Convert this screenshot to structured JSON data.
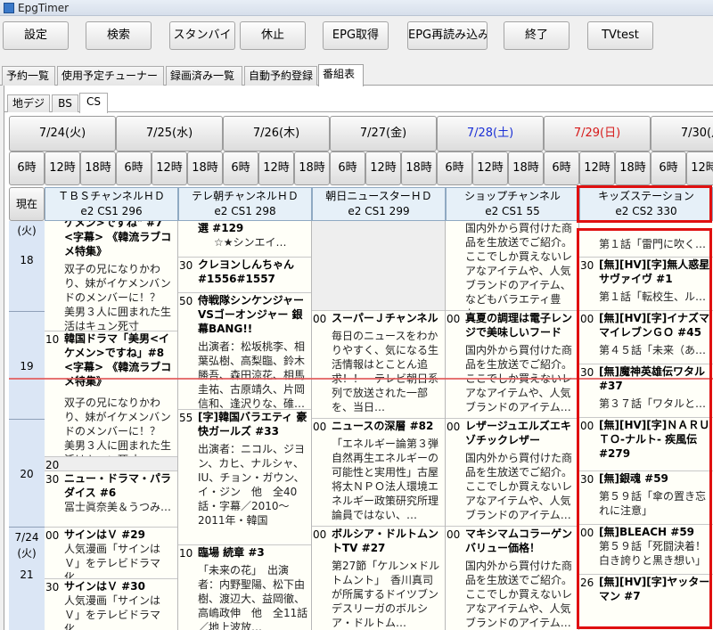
{
  "window": {
    "title": "EpgTimer"
  },
  "toolbar": {
    "buttons": [
      {
        "label": "設定"
      },
      {
        "label": "検索"
      },
      {
        "label": "スタンバイ"
      },
      {
        "label": "休止"
      },
      {
        "label": "EPG取得"
      },
      {
        "label": "EPG再読み込み"
      },
      {
        "label": "終了"
      },
      {
        "label": "TVtest"
      }
    ]
  },
  "main_tabs": [
    {
      "label": "予約一覧"
    },
    {
      "label": "使用予定チューナー"
    },
    {
      "label": "録画済み一覧"
    },
    {
      "label": "自動予約登録"
    },
    {
      "label": "番組表"
    }
  ],
  "sub_tabs": [
    {
      "label": "地デジ"
    },
    {
      "label": "BS"
    },
    {
      "label": "CS"
    }
  ],
  "dates": [
    {
      "label": "7/24(火)",
      "kind": "weekday"
    },
    {
      "label": "7/25(水)",
      "kind": "weekday"
    },
    {
      "label": "7/26(木)",
      "kind": "weekday"
    },
    {
      "label": "7/27(金)",
      "kind": "weekday"
    },
    {
      "label": "7/28(土)",
      "kind": "sat"
    },
    {
      "label": "7/29(日)",
      "kind": "sun"
    },
    {
      "label": "7/30(月)",
      "kind": "weekday"
    }
  ],
  "hours": [
    "6時",
    "12時",
    "18時",
    "6時",
    "12時",
    "18時",
    "6時",
    "12時",
    "18時",
    "6時",
    "12時",
    "18時",
    "6時",
    "12時",
    "18時",
    "6時",
    "12時",
    "18時",
    "6時",
    "12時"
  ],
  "now_button": "現在",
  "channels": [
    {
      "name": "ＴＢＳチャンネルＨＤ",
      "id": "e2 CS1 296"
    },
    {
      "name": "テレ朝チャンネルＨＤ",
      "id": "e2 CS1 298"
    },
    {
      "name": "朝日ニュースターＨＤ",
      "id": "e2 CS1 299"
    },
    {
      "name": "ショップチャンネル",
      "id": "e2 CS1 55"
    },
    {
      "name": "キッズステーション",
      "id": "e2 CS2 330"
    }
  ],
  "time_column": [
    {
      "day": "(火)",
      "hour": "18"
    },
    {
      "day": "",
      "hour": "19"
    },
    {
      "day": "",
      "hour": "20"
    },
    {
      "day": "7/24\n(火)",
      "hour": "21"
    }
  ],
  "programs": {
    "ch0": [
      {
        "min": "",
        "title": "ケメン>ですね\" #7　<字幕> 《韓流ラブコメ特集》",
        "desc": "双子の兄になりかわり、妹がイケメンバンドのメンバーに！？　美男３人に囲まれた生活はキュン死寸前！　…"
      },
      {
        "min": "10",
        "title": "韓国ドラマ「美男<イケメン>ですね」#8　<字幕> 《韓流ラブコメ特集》",
        "desc": "双子の兄になりかわり、妹がイケメンバンドのメンバーに！？　美男３人に囲まれた生活はキュン死寸前！　…"
      },
      {
        "min": "20",
        "title": "",
        "desc": ""
      },
      {
        "min": "30",
        "title": "ニュー・ドラマ・パラダイス #6",
        "desc": "冨士眞奈美＆うつみ…"
      },
      {
        "min": "00",
        "title": "サインはＶ #29",
        "desc": "人気漫画「サインはＶ」をテレビドラマ化…"
      },
      {
        "min": "30",
        "title": "サインはＶ #30",
        "desc": "人気漫画「サインはＶ」をテレビドラマ化…"
      }
    ],
    "ch1": [
      {
        "min": "",
        "title": "選 #129",
        "desc": "☆★シンエイ…"
      },
      {
        "min": "30",
        "title": "クレヨンしんちゃん #1556#1557",
        "desc": ""
      },
      {
        "min": "50",
        "title": "侍戦隊シンケンジャーVSゴーオンジャー 銀幕BANG!!",
        "desc": "出演者：松坂桃李、相葉弘樹、高梨臨、鈴木勝吾、森田涼花、相馬圭祐、古原靖久、片岡信和、逢沢りな、碓…"
      },
      {
        "min": "55",
        "title": "[字]韓国バラエティ 豪快ガールズ #33",
        "desc": "出演者：ニコル、ジヨン、カヒ、ナルシャ、IU、チョン・ガウン、イ・ジン　他　全40話・字幕／2010～2011年・韓国"
      },
      {
        "min": "10",
        "title": "臨場 続章 #3",
        "desc": "「未来の花」　出演者：内野聖陽、松下由樹、渡辺大、益岡徹、高嶋政伸　他　全11話／地上波放…"
      }
    ],
    "ch2": [
      {
        "min": "",
        "title": "",
        "desc": ""
      },
      {
        "min": "00",
        "title": "スーパーＪチャンネル",
        "desc": "毎日のニュースをわかりやすく、気になる生活情報はとことん追求！！　テレビ朝日系列で放送された一部を、当日…"
      },
      {
        "min": "00",
        "title": "ニュースの深層 #82",
        "desc": "「エネルギー論第３弾　自然再生エネルギーの可能性と実用性」古屋将太ＮＰＯ法人環境エネルギー政策研究所理論員ではない、…"
      },
      {
        "min": "00",
        "title": "ボルシア・ドルトムントTV #27",
        "desc": "第27節「ケルン×ドルトムント」　香川真司が所属するドイツブンデスリーガのボルシア・ドルトム…"
      }
    ],
    "ch3": [
      {
        "min": "",
        "title": "",
        "desc": "国内外から買付けた商品を生放送でご紹介。ここでしか買えないレアなアイテムや、人気ブランドのアイテム、などもバラエティ豊か…"
      },
      {
        "min": "00",
        "title": "真夏の調理は電子レンジで美味しいフード",
        "desc": "国内外から買付けた商品を生放送でご紹介。ここでしか買えないレアなアイテムや、人気ブランドのアイテム…"
      },
      {
        "min": "00",
        "title": "レザージュエルズエキゾチックレザー",
        "desc": "国内外から買付けた商品を生放送でご紹介。ここでしか買えないレアなアイテムや、人気ブランドのアイテム…"
      },
      {
        "min": "00",
        "title": "マキシマムコラーゲンバリュー価格！",
        "desc": "国内外から買付けた商品を生放送でご紹介。ここでしか買えないレアなアイテムや、人気ブランドのアイテム…"
      }
    ],
    "ch4": [
      {
        "min": "",
        "title": "",
        "desc": "第１話「雷門に吹く…"
      },
      {
        "min": "30",
        "title": "[無][HV][字]無人惑星サヴァイヴ #1",
        "desc": "第１話「転校生、ル…"
      },
      {
        "min": "00",
        "title": "[無][HV][字]イナズママイレブンＧＯ #45",
        "desc": "第４５話「未来（あ…"
      },
      {
        "min": "30",
        "title": "[無]魔神英雄伝ワタル #37",
        "desc": "第３７話「ワタルと…"
      },
      {
        "min": "00",
        "title": "[無][HV][字]ＮＡＲＵＴＯ-ナルト- 疾風伝 #279",
        "desc": ""
      },
      {
        "min": "30",
        "title": "[無]銀魂 #59",
        "desc": "第５９話「傘の置き忘れに注意」"
      },
      {
        "min": "00",
        "title": "[無]BLEACH #59",
        "desc": "第５９話「死闘決着！白き誇りと黒き想い」"
      },
      {
        "min": "26",
        "title": "[無][HV][字]ヤッターマン #7",
        "desc": ""
      }
    ]
  }
}
